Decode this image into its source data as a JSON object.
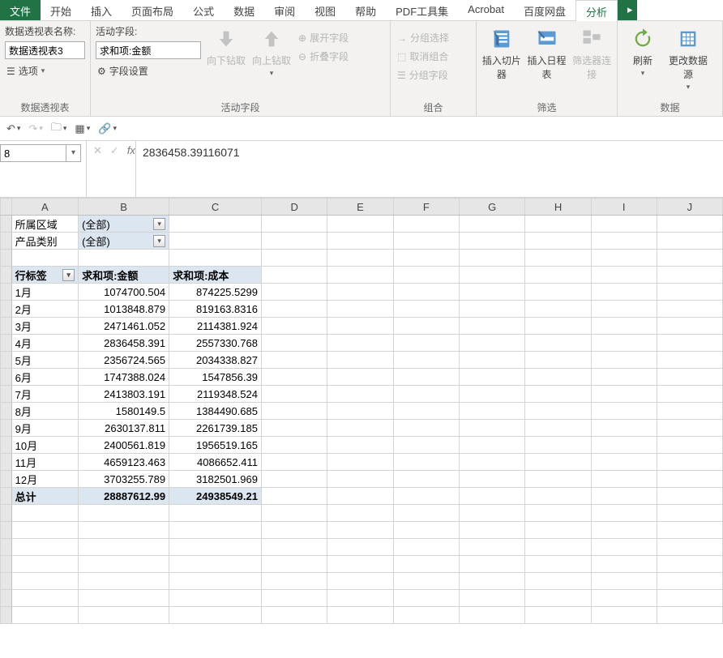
{
  "tabs": [
    "文件",
    "开始",
    "插入",
    "页面布局",
    "公式",
    "数据",
    "审阅",
    "视图",
    "帮助",
    "PDF工具集",
    "Acrobat",
    "百度网盘",
    "分析"
  ],
  "pivot": {
    "name_label": "数据透视表名称:",
    "name_value": "数据透视表3",
    "options_label": "选项",
    "group_label": "数据透视表",
    "active_field_label": "活动字段:",
    "active_field_value": "求和项:金额",
    "field_settings": "字段设置",
    "drill_down": "向下钻取",
    "drill_up": "向上钻取",
    "expand_field": "展开字段",
    "collapse_field": "折叠字段",
    "active_group_label": "活动字段",
    "group_select": "分组选择",
    "ungroup": "取消组合",
    "group_field": "分组字段",
    "group_label2": "组合",
    "slicer": "插入切片器",
    "timeline": "插入日程表",
    "filter_conn": "筛选器连接",
    "filter_group": "筛选",
    "refresh": "刷新",
    "change_src": "更改数据源",
    "data_group": "数据"
  },
  "namebox": "8",
  "formula": "2836458.39116071",
  "cols": [
    "A",
    "B",
    "C",
    "D",
    "E",
    "F",
    "G",
    "H",
    "I",
    "J"
  ],
  "filters": [
    {
      "label": "所属区域",
      "value": "(全部)"
    },
    {
      "label": "产品类别",
      "value": "(全部)"
    }
  ],
  "headers": [
    "行标签",
    "求和项:金额",
    "求和项:成本"
  ],
  "rows": [
    {
      "m": "1月",
      "a": "1074700.504",
      "c": "874225.5299"
    },
    {
      "m": "2月",
      "a": "1013848.879",
      "c": "819163.8316"
    },
    {
      "m": "3月",
      "a": "2471461.052",
      "c": "2114381.924"
    },
    {
      "m": "4月",
      "a": "2836458.391",
      "c": "2557330.768"
    },
    {
      "m": "5月",
      "a": "2356724.565",
      "c": "2034338.827"
    },
    {
      "m": "6月",
      "a": "1747388.024",
      "c": "1547856.39"
    },
    {
      "m": "7月",
      "a": "2413803.191",
      "c": "2119348.524"
    },
    {
      "m": "8月",
      "a": "1580149.5",
      "c": "1384490.685"
    },
    {
      "m": "9月",
      "a": "2630137.811",
      "c": "2261739.185"
    },
    {
      "m": "10月",
      "a": "2400561.819",
      "c": "1956519.165"
    },
    {
      "m": "11月",
      "a": "4659123.463",
      "c": "4086652.411"
    },
    {
      "m": "12月",
      "a": "3703255.789",
      "c": "3182501.969"
    }
  ],
  "total": {
    "label": "总计",
    "a": "28887612.99",
    "c": "24938549.21"
  }
}
